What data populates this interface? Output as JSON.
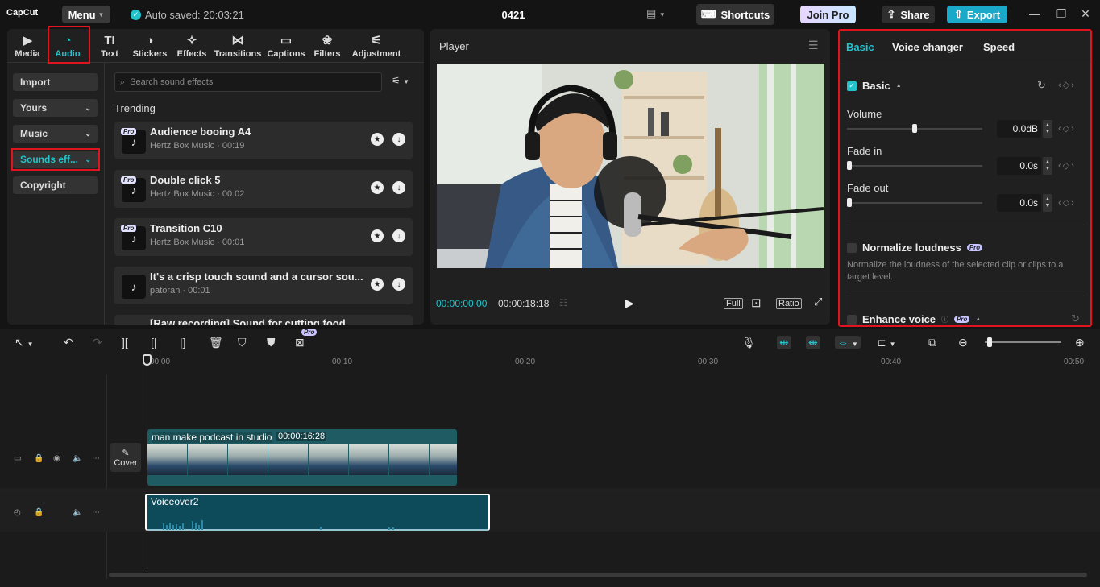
{
  "app": {
    "logo": "CapCut",
    "menu_label": "Menu",
    "autosave": "Auto saved: 20:03:21",
    "project_title": "0421",
    "shortcuts_label": "Shortcuts",
    "joinpro_label": "Join Pro",
    "share_label": "Share",
    "export_label": "Export",
    "accent": "#22c3cc",
    "highlight": "#e0141e"
  },
  "tabs": [
    {
      "label": "Media",
      "icon": "media-icon"
    },
    {
      "label": "Audio",
      "icon": "audio-icon",
      "active": true
    },
    {
      "label": "Text",
      "icon": "text-icon"
    },
    {
      "label": "Stickers",
      "icon": "stickers-icon"
    },
    {
      "label": "Effects",
      "icon": "effects-icon"
    },
    {
      "label": "Transitions",
      "icon": "transitions-icon"
    },
    {
      "label": "Captions",
      "icon": "captions-icon"
    },
    {
      "label": "Filters",
      "icon": "filters-icon"
    },
    {
      "label": "Adjustment",
      "icon": "adjustment-icon"
    }
  ],
  "sidebar": [
    {
      "label": "Import"
    },
    {
      "label": "Yours"
    },
    {
      "label": "Music"
    },
    {
      "label": "Sounds eff...",
      "active": true
    },
    {
      "label": "Copyright"
    }
  ],
  "search": {
    "placeholder": "Search sound effects"
  },
  "trending_label": "Trending",
  "sounds": [
    {
      "title": "Audience booing A4",
      "sub": "Hertz Box Music · 00:19",
      "pro": "Pro"
    },
    {
      "title": "Double click 5",
      "sub": "Hertz Box Music · 00:02",
      "pro": "Pro"
    },
    {
      "title": "Transition C10",
      "sub": "Hertz Box Music · 00:01",
      "pro": "Pro"
    },
    {
      "title": "It's a crisp touch sound and a cursor sou...",
      "sub": "patoran · 00:01",
      "pro": ""
    },
    {
      "title": "[Raw recording] Sound for cutting food",
      "sub": "",
      "pro": ""
    }
  ],
  "player": {
    "title": "Player",
    "current_time": "00:00:00:00",
    "total_time": "00:00:18:18",
    "full_label": "Full",
    "ratio_label": "Ratio"
  },
  "right": {
    "tabs": [
      "Basic",
      "Voice changer",
      "Speed"
    ],
    "section": "Basic",
    "volume_label": "Volume",
    "volume_value": "0.0dB",
    "volume_level": 0.5,
    "fadein_label": "Fade in",
    "fadein_value": "0.0s",
    "fadeout_label": "Fade out",
    "fadeout_value": "0.0s",
    "normalize_label": "Normalize loudness",
    "normalize_desc": "Normalize the loudness of the selected clip or clips to a target level.",
    "enhance_label": "Enhance voice",
    "pro": "Pro"
  },
  "timeline": {
    "ruler": [
      "00:00",
      "00:10",
      "00:20",
      "00:30",
      "00:40",
      "00:50"
    ],
    "cover_label": "Cover",
    "video_clip_name": "man make podcast in studio",
    "video_clip_duration": "00:00:16:28",
    "audio_clip_name": "Voiceover2",
    "pro": "Pro"
  }
}
